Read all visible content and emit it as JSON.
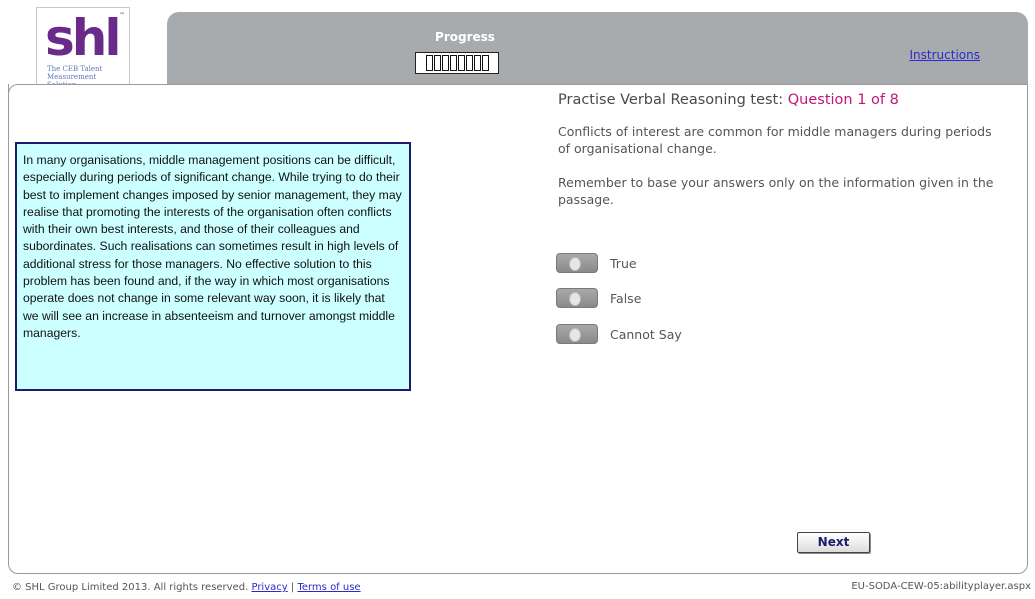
{
  "brand": {
    "logo_text": "shl",
    "tm": "™",
    "tagline": "The CEB Talent Measurement Solution"
  },
  "header": {
    "progress_label": "Progress",
    "progress": {
      "completed": 0,
      "total": 8
    },
    "instructions_link": "Instructions"
  },
  "passage": {
    "text": "In many organisations, middle management positions can be difficult, especially during periods of significant change. While trying to do their best to implement changes imposed by senior management, they may realise that promoting the interests of the organisation often conflicts with their own best interests, and those of their colleagues and subordinates. Such realisations can sometimes result in high levels of additional stress for those managers. No effective solution to this problem has been found and, if the way in which most organisations operate does not change in some relevant way soon, it is likely that we will see an increase in absenteeism and turnover amongst middle managers."
  },
  "question": {
    "title_prefix": "Practise Verbal Reasoning test: ",
    "title_count": "Question 1 of 8",
    "statement": "Conflicts of interest are common for middle managers during periods of organisational change.",
    "reminder": "Remember to base your answers only on the information given in the passage.",
    "options": [
      {
        "label": "True"
      },
      {
        "label": "False"
      },
      {
        "label": "Cannot Say"
      }
    ],
    "next_label": "Next"
  },
  "footer": {
    "copyright": "© SHL Group Limited 2013. All rights reserved.",
    "privacy": "Privacy",
    "separator": "|",
    "terms": "Terms of use",
    "page_id": "EU-SODA-CEW-05:abilityplayer.aspx"
  },
  "colors": {
    "brand_purple": "#6a2a8a",
    "header_grey": "#a8abad",
    "passage_bg": "#ccffff",
    "passage_border": "#1c1c6e",
    "question_count": "#c0187a",
    "link": "#2a2ad0"
  }
}
